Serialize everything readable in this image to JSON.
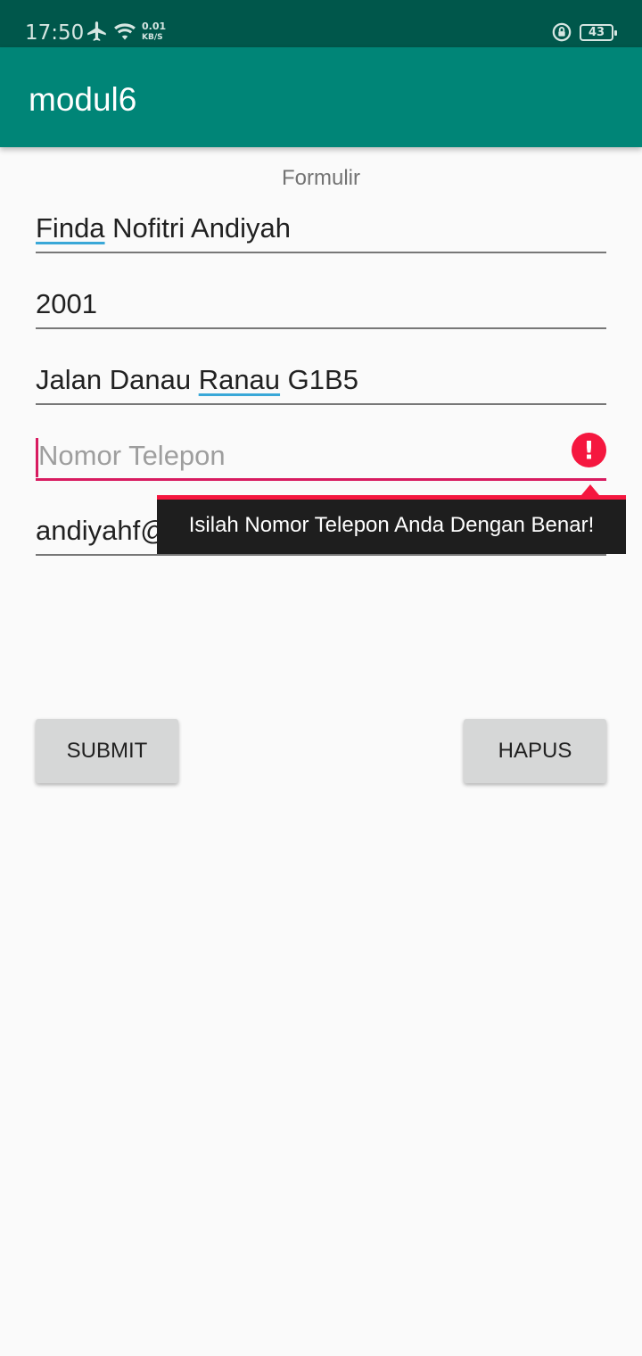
{
  "status_bar": {
    "time": "17:50",
    "net_speed_value": "0.01",
    "net_speed_unit": "KB/S",
    "battery": "43"
  },
  "app_bar": {
    "title": "modul6"
  },
  "form": {
    "title": "Formulir",
    "name": {
      "word1": "Finda",
      "rest": " Nofitri Andiyah"
    },
    "year": "2001",
    "address": {
      "part1": "Jalan Danau ",
      "underlined": "Ranau",
      "part2": " G1B5"
    },
    "phone": {
      "placeholder": "Nomor Telepon",
      "error_message": "Isilah Nomor Telepon Anda Dengan Benar!"
    },
    "email": "andiyahf@gmail.com"
  },
  "buttons": {
    "submit": "SUBMIT",
    "clear": "HAPUS"
  },
  "colors": {
    "primary": "#008577",
    "primary_dark": "#00574b",
    "error": "#f5173f",
    "accent": "#d81b60"
  }
}
